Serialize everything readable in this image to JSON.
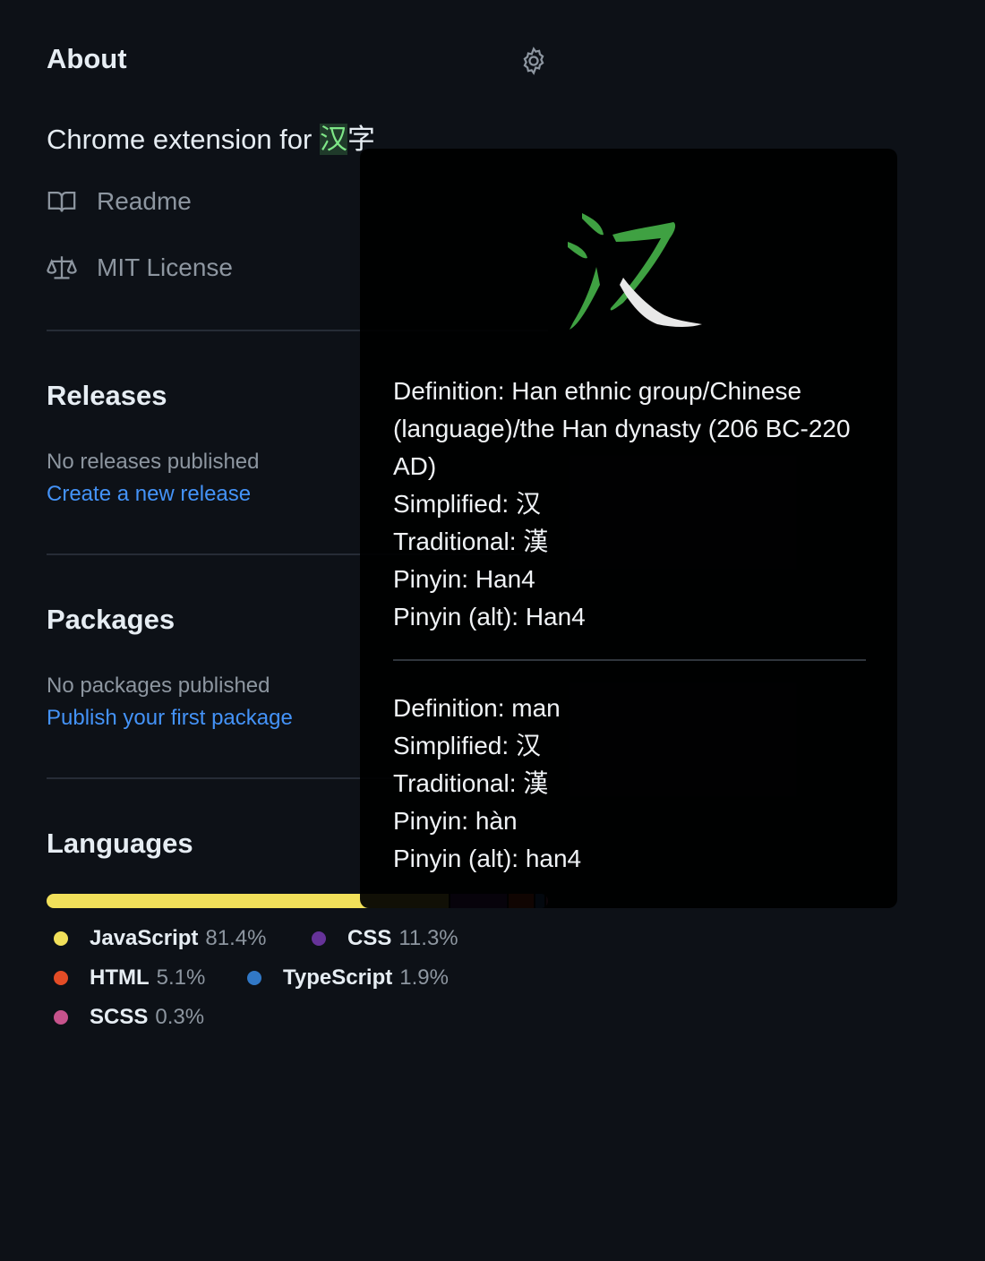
{
  "about": {
    "title": "About",
    "description_prefix": "Chrome extension for ",
    "description_highlight": "汉",
    "description_suffix": "字",
    "readme": "Readme",
    "license": "MIT License",
    "settings_icon": "gear-icon"
  },
  "releases": {
    "title": "Releases",
    "empty": "No releases published",
    "link": "Create a new release"
  },
  "packages": {
    "title": "Packages",
    "empty": "No packages published",
    "link": "Publish your first package"
  },
  "languages": {
    "title": "Languages",
    "items": [
      {
        "name": "JavaScript",
        "percent": "81.4%",
        "value": 81.4,
        "color": "#f1e05a"
      },
      {
        "name": "CSS",
        "percent": "11.3%",
        "value": 11.3,
        "color": "#663399"
      },
      {
        "name": "HTML",
        "percent": "5.1%",
        "value": 5.1,
        "color": "#e34c26"
      },
      {
        "name": "TypeScript",
        "percent": "1.9%",
        "value": 1.9,
        "color": "#3178c6"
      },
      {
        "name": "SCSS",
        "percent": "0.3%",
        "value": 0.3,
        "color": "#c6538c"
      }
    ]
  },
  "popup": {
    "character": "汉",
    "stroke_color": "#3fa142",
    "entries": [
      {
        "definition": "Definition: Han ethnic group/Chinese (language)/the Han dynasty (206 BC-220 AD)",
        "simplified": "Simplified: 汉",
        "traditional": "Traditional: 漢",
        "pinyin": "Pinyin: Han4",
        "pinyin_alt": "Pinyin (alt): Han4"
      },
      {
        "definition": "Definition: man",
        "simplified": "Simplified: 汉",
        "traditional": "Traditional: 漢",
        "pinyin": "Pinyin: hàn",
        "pinyin_alt": "Pinyin (alt): han4"
      }
    ]
  }
}
